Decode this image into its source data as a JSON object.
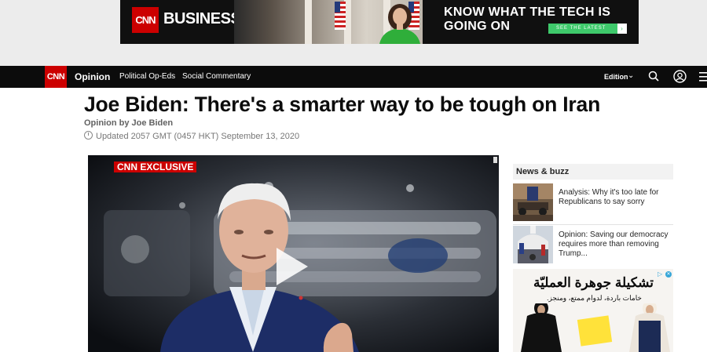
{
  "ad_banner": {
    "brand_logo": "CNN",
    "brand_name": "BUSINESS",
    "tagline": "KNOW WHAT THE TECH IS GOING ON",
    "cta_label": "SEE THE LATEST",
    "cta_arrow": "›",
    "accent_color": "#3ec96b"
  },
  "nav": {
    "logo": "CNN",
    "section": "Opinion",
    "links": [
      "Political Op-Eds",
      "Social Commentary"
    ],
    "edition_label": "Edition",
    "edition_chevron": "⌄",
    "icons": [
      "search-icon",
      "user-icon",
      "menu-icon"
    ],
    "brand_color": "#cc0000"
  },
  "article": {
    "headline": "Joe Biden: There's a smarter way to be tough on Iran",
    "byline": "Opinion by Joe Biden",
    "updated": "Updated 2057 GMT (0457 HKT) September 13, 2020"
  },
  "video": {
    "badge": "CNN EXCLUSIVE",
    "icons": [
      "play-icon"
    ]
  },
  "sidebar": {
    "header": "News & buzz",
    "stories": [
      {
        "title": "Analysis: Why it's too late for Republicans to say sorry"
      },
      {
        "title": "Opinion: Saving our democracy requires more than removing Trump..."
      }
    ]
  },
  "side_ad": {
    "headline_ar": "تشكيلة جوهرة العمليّة",
    "sub_ar": "خامات باردة، لدوام ممتع، ومنجز.",
    "close_glyph": "✕",
    "info_glyph": "▷",
    "accent_color": "#36a6d8"
  }
}
